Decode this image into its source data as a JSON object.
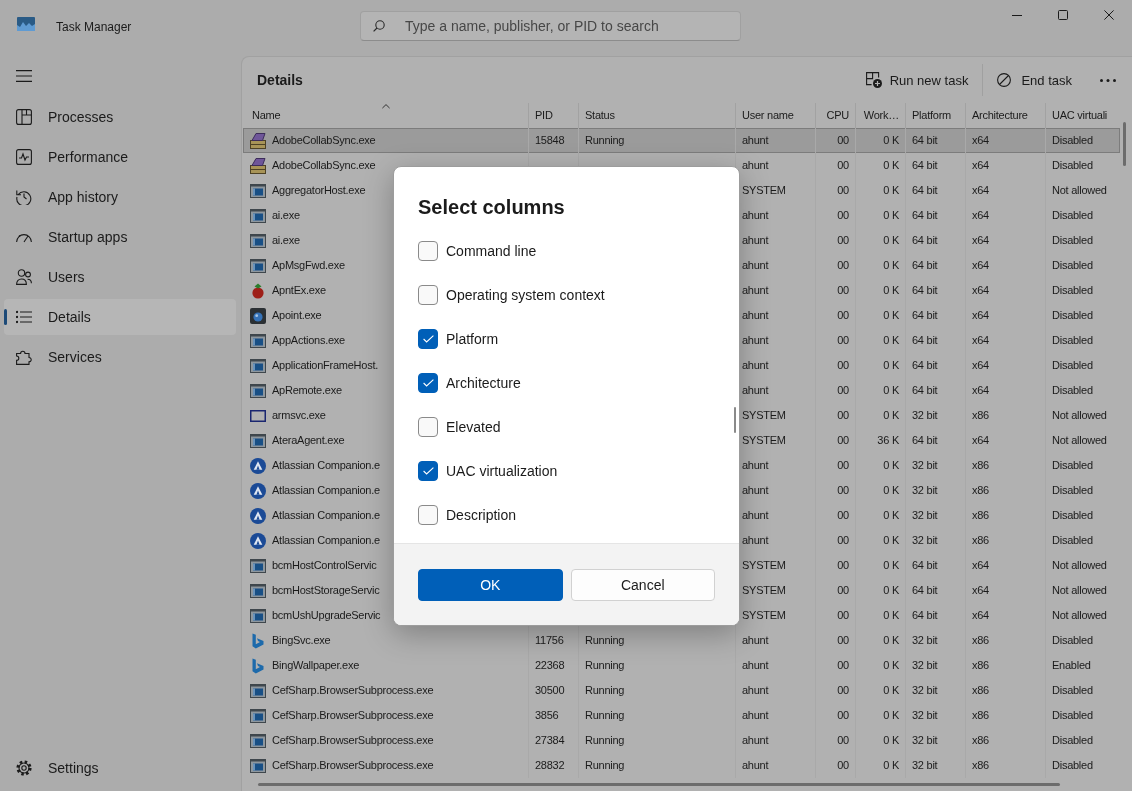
{
  "window": {
    "title": "Task Manager"
  },
  "search": {
    "placeholder": "Type a name, publisher, or PID to search"
  },
  "sidebar": {
    "items": [
      {
        "label": "Processes",
        "kind": "tiles",
        "selected": false
      },
      {
        "label": "Performance",
        "kind": "pulse",
        "selected": false
      },
      {
        "label": "App history",
        "kind": "history",
        "selected": false
      },
      {
        "label": "Startup apps",
        "kind": "gauge",
        "selected": false
      },
      {
        "label": "Users",
        "kind": "people",
        "selected": false
      },
      {
        "label": "Details",
        "kind": "list",
        "selected": true
      },
      {
        "label": "Services",
        "kind": "puzzle",
        "selected": false
      }
    ],
    "footer_items": [
      {
        "label": "Settings",
        "kind": "gear",
        "selected": false
      }
    ]
  },
  "panel": {
    "title": "Details",
    "toolbar": [
      {
        "label": "Run new task",
        "kind": "run"
      },
      {
        "label": "End task",
        "kind": "end"
      },
      {
        "kind": "more"
      }
    ]
  },
  "table": {
    "columns": [
      {
        "label": "Name",
        "kind": "text",
        "sorted": true
      },
      {
        "label": "PID",
        "kind": "text",
        "sorted": false
      },
      {
        "label": "Status",
        "kind": "text",
        "sorted": false
      },
      {
        "label": "User name",
        "kind": "text",
        "sorted": false
      },
      {
        "label": "CPU",
        "kind": "number",
        "sorted": false
      },
      {
        "label": "Work…",
        "kind": "number",
        "sorted": false
      },
      {
        "label": "Platform",
        "kind": "text",
        "sorted": false
      },
      {
        "label": "Architecture",
        "kind": "text",
        "sorted": false
      },
      {
        "label": "UAC virtuali",
        "kind": "text",
        "sorted": false
      }
    ],
    "rows": [
      {
        "kind": "package",
        "name": "AdobeCollabSync.exe",
        "pid": "15848",
        "status": "Running",
        "user_name": "ahunt",
        "cpu": "00",
        "work": "0 K",
        "platform": "64 bit",
        "architecture": "x64",
        "uac": "Disabled",
        "selected": true
      },
      {
        "kind": "package",
        "name": "AdobeCollabSync.exe",
        "user_name": "ahunt",
        "cpu": "00",
        "work": "0 K",
        "platform": "64 bit",
        "architecture": "x64",
        "uac": "Disabled",
        "selected": false
      },
      {
        "kind": "window",
        "name": "AggregatorHost.exe",
        "user_name": "SYSTEM",
        "cpu": "00",
        "work": "0 K",
        "platform": "64 bit",
        "architecture": "x64",
        "uac": "Not allowed",
        "selected": false
      },
      {
        "kind": "window",
        "name": "ai.exe",
        "user_name": "ahunt",
        "cpu": "00",
        "work": "0 K",
        "platform": "64 bit",
        "architecture": "x64",
        "uac": "Disabled",
        "selected": false
      },
      {
        "kind": "window",
        "name": "ai.exe",
        "user_name": "ahunt",
        "cpu": "00",
        "work": "0 K",
        "platform": "64 bit",
        "architecture": "x64",
        "uac": "Disabled",
        "selected": false
      },
      {
        "kind": "window",
        "name": "ApMsgFwd.exe",
        "user_name": "ahunt",
        "cpu": "00",
        "work": "0 K",
        "platform": "64 bit",
        "architecture": "x64",
        "uac": "Disabled",
        "selected": false
      },
      {
        "kind": "fruit",
        "name": "ApntEx.exe",
        "user_name": "ahunt",
        "cpu": "00",
        "work": "0 K",
        "platform": "64 bit",
        "architecture": "x64",
        "uac": "Disabled",
        "selected": false
      },
      {
        "kind": "lens",
        "name": "Apoint.exe",
        "user_name": "ahunt",
        "cpu": "00",
        "work": "0 K",
        "platform": "64 bit",
        "architecture": "x64",
        "uac": "Disabled",
        "selected": false
      },
      {
        "kind": "window",
        "name": "AppActions.exe",
        "user_name": "ahunt",
        "cpu": "00",
        "work": "0 K",
        "platform": "64 bit",
        "architecture": "x64",
        "uac": "Disabled",
        "selected": false
      },
      {
        "kind": "window",
        "name": "ApplicationFrameHost.",
        "user_name": "ahunt",
        "cpu": "00",
        "work": "0 K",
        "platform": "64 bit",
        "architecture": "x64",
        "uac": "Disabled",
        "selected": false
      },
      {
        "kind": "window",
        "name": "ApRemote.exe",
        "user_name": "ahunt",
        "cpu": "00",
        "work": "0 K",
        "platform": "64 bit",
        "architecture": "x64",
        "uac": "Disabled",
        "selected": false
      },
      {
        "kind": "outline",
        "name": "armsvc.exe",
        "user_name": "SYSTEM",
        "cpu": "00",
        "work": "0 K",
        "platform": "32 bit",
        "architecture": "x86",
        "uac": "Not allowed",
        "selected": false
      },
      {
        "kind": "window",
        "name": "AteraAgent.exe",
        "user_name": "SYSTEM",
        "cpu": "00",
        "work": "36 K",
        "platform": "64 bit",
        "architecture": "x64",
        "uac": "Not allowed",
        "selected": false
      },
      {
        "kind": "peak",
        "name": "Atlassian Companion.e",
        "user_name": "ahunt",
        "cpu": "00",
        "work": "0 K",
        "platform": "32 bit",
        "architecture": "x86",
        "uac": "Disabled",
        "selected": false
      },
      {
        "kind": "peak",
        "name": "Atlassian Companion.e",
        "user_name": "ahunt",
        "cpu": "00",
        "work": "0 K",
        "platform": "32 bit",
        "architecture": "x86",
        "uac": "Disabled",
        "selected": false
      },
      {
        "kind": "peak",
        "name": "Atlassian Companion.e",
        "user_name": "ahunt",
        "cpu": "00",
        "work": "0 K",
        "platform": "32 bit",
        "architecture": "x86",
        "uac": "Disabled",
        "selected": false
      },
      {
        "kind": "peak",
        "name": "Atlassian Companion.e",
        "user_name": "ahunt",
        "cpu": "00",
        "work": "0 K",
        "platform": "32 bit",
        "architecture": "x86",
        "uac": "Disabled",
        "selected": false
      },
      {
        "kind": "window",
        "name": "bcmHostControlServic",
        "user_name": "SYSTEM",
        "cpu": "00",
        "work": "0 K",
        "platform": "64 bit",
        "architecture": "x64",
        "uac": "Not allowed",
        "selected": false
      },
      {
        "kind": "window",
        "name": "bcmHostStorageServic",
        "user_name": "SYSTEM",
        "cpu": "00",
        "work": "0 K",
        "platform": "64 bit",
        "architecture": "x64",
        "uac": "Not allowed",
        "selected": false
      },
      {
        "kind": "window",
        "name": "bcmUshUpgradeServic",
        "user_name": "SYSTEM",
        "cpu": "00",
        "work": "0 K",
        "platform": "64 bit",
        "architecture": "x64",
        "uac": "Not allowed",
        "selected": false
      },
      {
        "kind": "letter",
        "name": "BingSvc.exe",
        "pid": "11756",
        "status": "Running",
        "user_name": "ahunt",
        "cpu": "00",
        "work": "0 K",
        "platform": "32 bit",
        "architecture": "x86",
        "uac": "Disabled",
        "selected": false
      },
      {
        "kind": "letter",
        "name": "BingWallpaper.exe",
        "pid": "22368",
        "status": "Running",
        "user_name": "ahunt",
        "cpu": "00",
        "work": "0 K",
        "platform": "32 bit",
        "architecture": "x86",
        "uac": "Enabled",
        "selected": false
      },
      {
        "kind": "window",
        "name": "CefSharp.BrowserSubprocess.exe",
        "pid": "30500",
        "status": "Running",
        "user_name": "ahunt",
        "cpu": "00",
        "work": "0 K",
        "platform": "32 bit",
        "architecture": "x86",
        "uac": "Disabled",
        "selected": false
      },
      {
        "kind": "window",
        "name": "CefSharp.BrowserSubprocess.exe",
        "pid": "3856",
        "status": "Running",
        "user_name": "ahunt",
        "cpu": "00",
        "work": "0 K",
        "platform": "32 bit",
        "architecture": "x86",
        "uac": "Disabled",
        "selected": false
      },
      {
        "kind": "window",
        "name": "CefSharp.BrowserSubprocess.exe",
        "pid": "27384",
        "status": "Running",
        "user_name": "ahunt",
        "cpu": "00",
        "work": "0 K",
        "platform": "32 bit",
        "architecture": "x86",
        "uac": "Disabled",
        "selected": false
      },
      {
        "kind": "window",
        "name": "CefSharp.BrowserSubprocess.exe",
        "pid": "28832",
        "status": "Running",
        "user_name": "ahunt",
        "cpu": "00",
        "work": "0 K",
        "platform": "32 bit",
        "architecture": "x86",
        "uac": "Disabled",
        "selected": false
      }
    ]
  },
  "dialog": {
    "title": "Select columns",
    "options": [
      {
        "label": "Command line",
        "checked": false
      },
      {
        "label": "Operating system context",
        "checked": false
      },
      {
        "label": "Platform",
        "checked": true
      },
      {
        "label": "Architecture",
        "checked": true
      },
      {
        "label": "Elevated",
        "checked": false
      },
      {
        "label": "UAC virtualization",
        "checked": true
      },
      {
        "label": "Description",
        "checked": false
      }
    ],
    "buttons": [
      {
        "label": "OK",
        "kind": "primary"
      },
      {
        "label": "Cancel",
        "kind": "secondary"
      }
    ]
  }
}
